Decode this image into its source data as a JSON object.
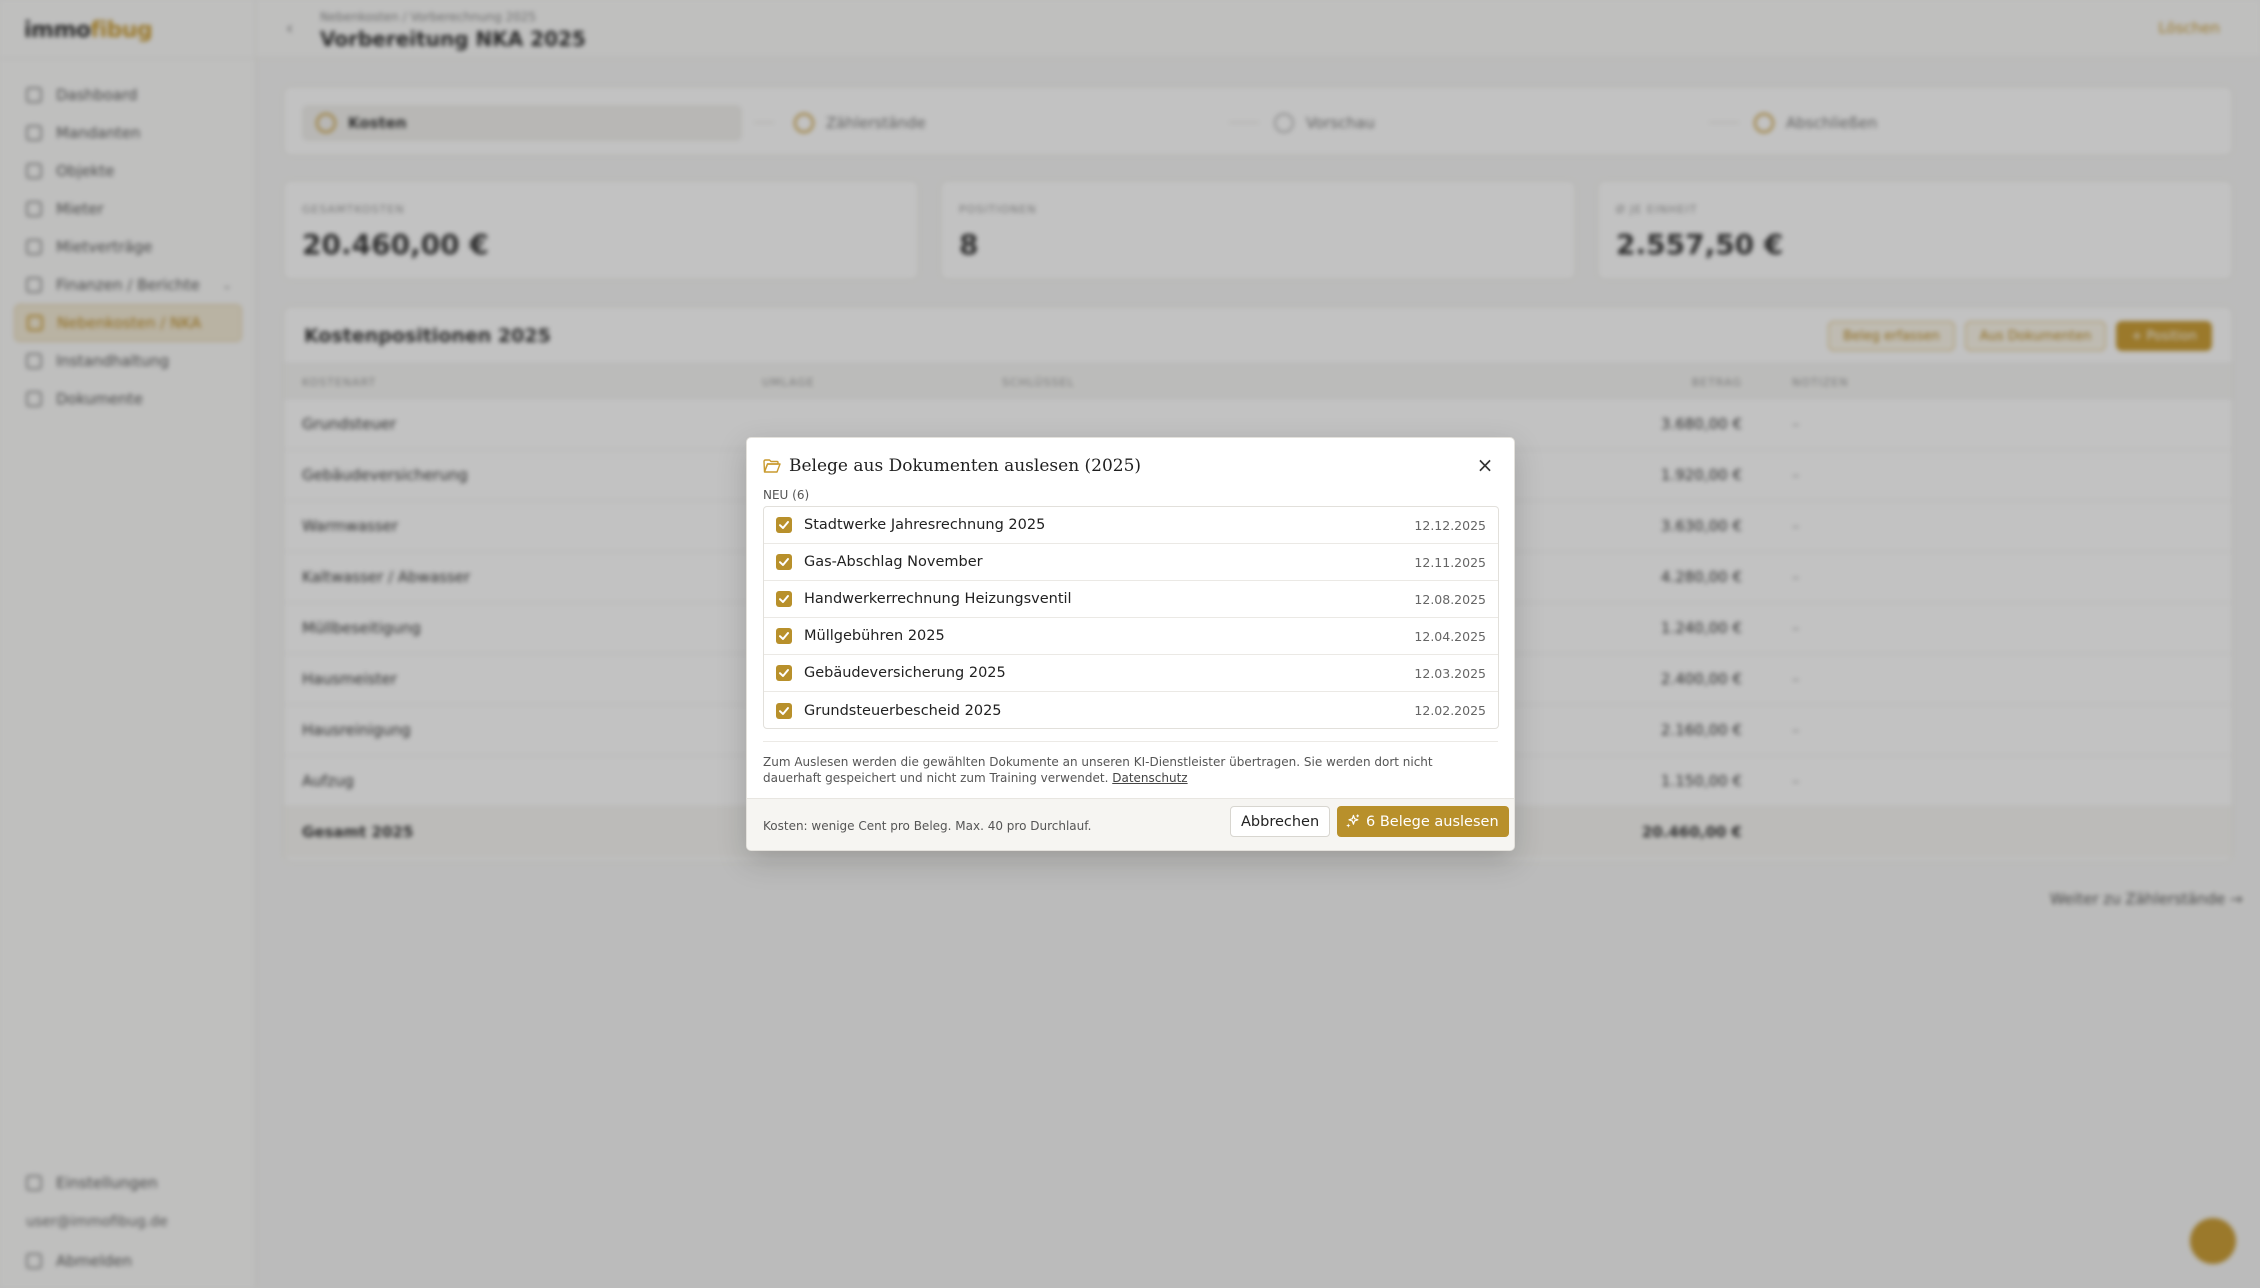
{
  "app": {
    "logo": {
      "part1": "immo",
      "part2": "fibug"
    },
    "nav": [
      {
        "label": "Dashboard"
      },
      {
        "label": "Mandanten"
      },
      {
        "label": "Objekte"
      },
      {
        "label": "Mieter"
      },
      {
        "label": "Mietverträge"
      },
      {
        "label": "Finanzen / Berichte"
      },
      {
        "label": "Nebenkosten / NKA"
      },
      {
        "label": "Instandhaltung"
      },
      {
        "label": "Dokumente"
      }
    ],
    "bottom_nav": {
      "settings": "Einstellungen",
      "email": "user@immofibug.de",
      "logout": "Abmelden"
    },
    "topbar": {
      "breadcrumb": "Nebenkosten / Vorberechnung 2025",
      "title": "Vorbereitung NKA 2025",
      "action": "Löschen"
    },
    "steps": [
      "Kosten",
      "Zählerstände",
      "Vorschau",
      "Abschließen"
    ],
    "stats": [
      {
        "label": "GESAMTKOSTEN",
        "value": "20.460,00 €"
      },
      {
        "label": "POSITIONEN",
        "value": "8"
      },
      {
        "label": "Ø JE EINHEIT",
        "value": "2.557,50 €"
      }
    ],
    "costs_card": {
      "title": "Kostenpositionen 2025",
      "actions": [
        "Beleg erfassen",
        "Aus Dokumenten",
        "+ Position"
      ],
      "headers": [
        "KOSTENART",
        "UMLAGE",
        "SCHLÜSSEL",
        "BETRAG",
        "NOTIZEN"
      ],
      "rows": [
        {
          "name": "Grundsteuer",
          "amount": "3.680,00 €",
          "note": "–"
        },
        {
          "name": "Gebäudeversicherung",
          "amount": "1.920,00 €",
          "note": "–"
        },
        {
          "name": "Warmwasser",
          "amount": "3.630,00 €",
          "note": "–"
        },
        {
          "name": "Kaltwasser / Abwasser",
          "amount": "4.280,00 €",
          "note": "–"
        },
        {
          "name": "Müllbeseitigung",
          "amount": "1.240,00 €",
          "note": "–"
        },
        {
          "name": "Hausmeister",
          "amount": "2.400,00 €",
          "note": "–"
        },
        {
          "name": "Hausreinigung",
          "amount": "2.160,00 €",
          "note": "–"
        },
        {
          "name": "Aufzug",
          "amount": "1.150,00 €",
          "note": "–"
        }
      ],
      "total": {
        "label": "Gesamt 2025",
        "amount": "20.460,00 €"
      }
    },
    "next_link": "Weiter zu Zählerstände →"
  },
  "modal": {
    "title": "Belege aus Dokumenten auslesen (2025)",
    "close": "×",
    "section_label": "NEU (6)",
    "items": [
      {
        "title": "Stadtwerke Jahresrechnung 2025",
        "date": "12.12.2025",
        "checked": true
      },
      {
        "title": "Gas-Abschlag November",
        "date": "12.11.2025",
        "checked": true
      },
      {
        "title": "Handwerkerrechnung Heizungsventil",
        "date": "12.08.2025",
        "checked": true
      },
      {
        "title": "Müllgebühren 2025",
        "date": "12.04.2025",
        "checked": true
      },
      {
        "title": "Gebäudeversicherung 2025",
        "date": "12.03.2025",
        "checked": true
      },
      {
        "title": "Grundsteuerbescheid 2025",
        "date": "12.02.2025",
        "checked": true
      }
    ],
    "note_text": "Zum Auslesen werden die gewählten Dokumente an unseren KI-Dienstleister übertragen. Sie werden dort nicht dauerhaft gespeichert und nicht zum Training verwendet.",
    "note_link": "Datenschutz",
    "cost_text": "Kosten: wenige Cent pro Beleg. Max. 40 pro Durchlauf.",
    "cancel_label": "Abbrechen",
    "submit_label": "6 Belege auslesen"
  },
  "colors": {
    "accent": "#b8902b",
    "overlay": "rgba(35,35,35,0.28)"
  }
}
